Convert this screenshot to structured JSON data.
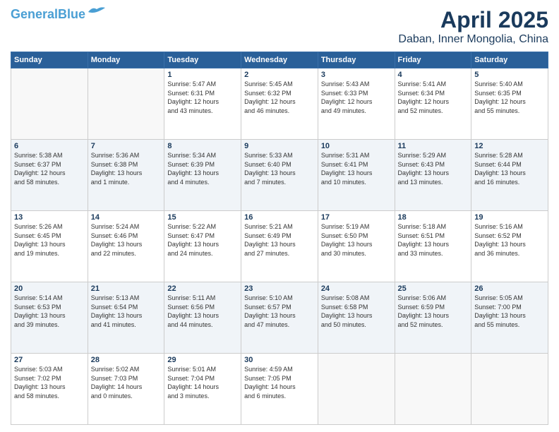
{
  "header": {
    "logo_general": "General",
    "logo_blue": "Blue",
    "title": "April 2025",
    "subtitle": "Daban, Inner Mongolia, China"
  },
  "days_of_week": [
    "Sunday",
    "Monday",
    "Tuesday",
    "Wednesday",
    "Thursday",
    "Friday",
    "Saturday"
  ],
  "weeks": [
    [
      {
        "day": "",
        "info": ""
      },
      {
        "day": "",
        "info": ""
      },
      {
        "day": "1",
        "info": "Sunrise: 5:47 AM\nSunset: 6:31 PM\nDaylight: 12 hours\nand 43 minutes."
      },
      {
        "day": "2",
        "info": "Sunrise: 5:45 AM\nSunset: 6:32 PM\nDaylight: 12 hours\nand 46 minutes."
      },
      {
        "day": "3",
        "info": "Sunrise: 5:43 AM\nSunset: 6:33 PM\nDaylight: 12 hours\nand 49 minutes."
      },
      {
        "day": "4",
        "info": "Sunrise: 5:41 AM\nSunset: 6:34 PM\nDaylight: 12 hours\nand 52 minutes."
      },
      {
        "day": "5",
        "info": "Sunrise: 5:40 AM\nSunset: 6:35 PM\nDaylight: 12 hours\nand 55 minutes."
      }
    ],
    [
      {
        "day": "6",
        "info": "Sunrise: 5:38 AM\nSunset: 6:37 PM\nDaylight: 12 hours\nand 58 minutes."
      },
      {
        "day": "7",
        "info": "Sunrise: 5:36 AM\nSunset: 6:38 PM\nDaylight: 13 hours\nand 1 minute."
      },
      {
        "day": "8",
        "info": "Sunrise: 5:34 AM\nSunset: 6:39 PM\nDaylight: 13 hours\nand 4 minutes."
      },
      {
        "day": "9",
        "info": "Sunrise: 5:33 AM\nSunset: 6:40 PM\nDaylight: 13 hours\nand 7 minutes."
      },
      {
        "day": "10",
        "info": "Sunrise: 5:31 AM\nSunset: 6:41 PM\nDaylight: 13 hours\nand 10 minutes."
      },
      {
        "day": "11",
        "info": "Sunrise: 5:29 AM\nSunset: 6:43 PM\nDaylight: 13 hours\nand 13 minutes."
      },
      {
        "day": "12",
        "info": "Sunrise: 5:28 AM\nSunset: 6:44 PM\nDaylight: 13 hours\nand 16 minutes."
      }
    ],
    [
      {
        "day": "13",
        "info": "Sunrise: 5:26 AM\nSunset: 6:45 PM\nDaylight: 13 hours\nand 19 minutes."
      },
      {
        "day": "14",
        "info": "Sunrise: 5:24 AM\nSunset: 6:46 PM\nDaylight: 13 hours\nand 22 minutes."
      },
      {
        "day": "15",
        "info": "Sunrise: 5:22 AM\nSunset: 6:47 PM\nDaylight: 13 hours\nand 24 minutes."
      },
      {
        "day": "16",
        "info": "Sunrise: 5:21 AM\nSunset: 6:49 PM\nDaylight: 13 hours\nand 27 minutes."
      },
      {
        "day": "17",
        "info": "Sunrise: 5:19 AM\nSunset: 6:50 PM\nDaylight: 13 hours\nand 30 minutes."
      },
      {
        "day": "18",
        "info": "Sunrise: 5:18 AM\nSunset: 6:51 PM\nDaylight: 13 hours\nand 33 minutes."
      },
      {
        "day": "19",
        "info": "Sunrise: 5:16 AM\nSunset: 6:52 PM\nDaylight: 13 hours\nand 36 minutes."
      }
    ],
    [
      {
        "day": "20",
        "info": "Sunrise: 5:14 AM\nSunset: 6:53 PM\nDaylight: 13 hours\nand 39 minutes."
      },
      {
        "day": "21",
        "info": "Sunrise: 5:13 AM\nSunset: 6:54 PM\nDaylight: 13 hours\nand 41 minutes."
      },
      {
        "day": "22",
        "info": "Sunrise: 5:11 AM\nSunset: 6:56 PM\nDaylight: 13 hours\nand 44 minutes."
      },
      {
        "day": "23",
        "info": "Sunrise: 5:10 AM\nSunset: 6:57 PM\nDaylight: 13 hours\nand 47 minutes."
      },
      {
        "day": "24",
        "info": "Sunrise: 5:08 AM\nSunset: 6:58 PM\nDaylight: 13 hours\nand 50 minutes."
      },
      {
        "day": "25",
        "info": "Sunrise: 5:06 AM\nSunset: 6:59 PM\nDaylight: 13 hours\nand 52 minutes."
      },
      {
        "day": "26",
        "info": "Sunrise: 5:05 AM\nSunset: 7:00 PM\nDaylight: 13 hours\nand 55 minutes."
      }
    ],
    [
      {
        "day": "27",
        "info": "Sunrise: 5:03 AM\nSunset: 7:02 PM\nDaylight: 13 hours\nand 58 minutes."
      },
      {
        "day": "28",
        "info": "Sunrise: 5:02 AM\nSunset: 7:03 PM\nDaylight: 14 hours\nand 0 minutes."
      },
      {
        "day": "29",
        "info": "Sunrise: 5:01 AM\nSunset: 7:04 PM\nDaylight: 14 hours\nand 3 minutes."
      },
      {
        "day": "30",
        "info": "Sunrise: 4:59 AM\nSunset: 7:05 PM\nDaylight: 14 hours\nand 6 minutes."
      },
      {
        "day": "",
        "info": ""
      },
      {
        "day": "",
        "info": ""
      },
      {
        "day": "",
        "info": ""
      }
    ]
  ]
}
